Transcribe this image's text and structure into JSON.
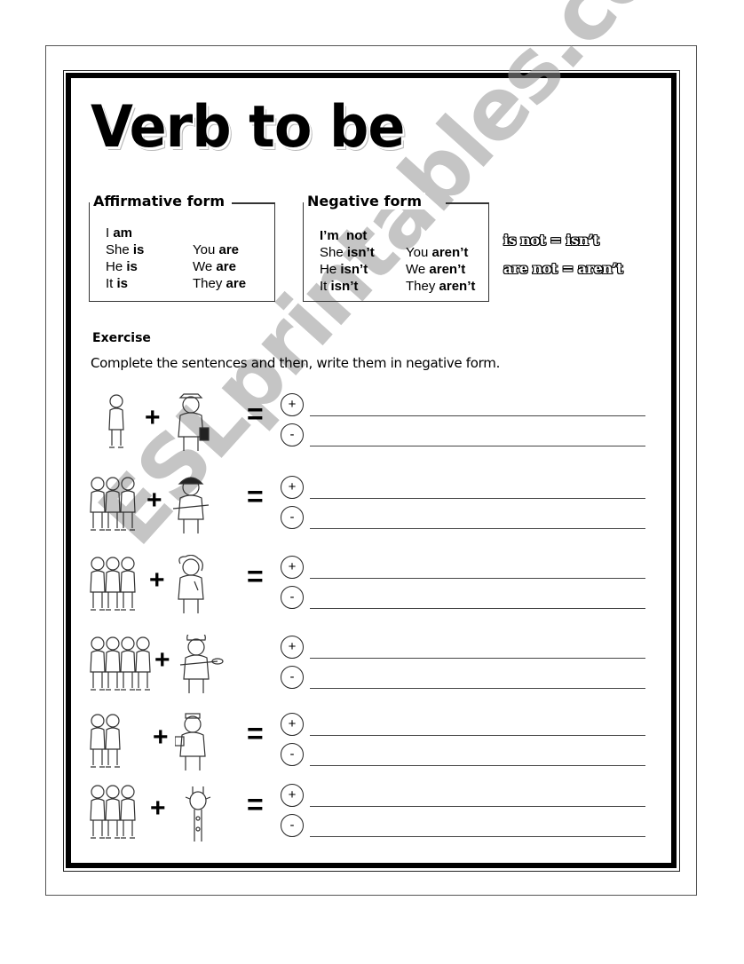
{
  "worksheet": {
    "title": "Verb to be",
    "affirmative": {
      "heading": "Affirmative form",
      "rows": [
        {
          "subject": "I",
          "verb": "am"
        },
        {
          "subject": "She",
          "verb": "is"
        },
        {
          "subject": "He",
          "verb": "is"
        },
        {
          "subject": "It",
          "verb": "is"
        },
        {
          "subject": "You",
          "verb": "are"
        },
        {
          "subject": "We",
          "verb": "are"
        },
        {
          "subject": "They",
          "verb": "are"
        }
      ]
    },
    "negative": {
      "heading": "Negative form",
      "rows": [
        {
          "subject": "I’m",
          "verb": "not"
        },
        {
          "subject": "She",
          "verb": "isn’t"
        },
        {
          "subject": "He",
          "verb": "isn’t"
        },
        {
          "subject": "It",
          "verb": "isn’t"
        },
        {
          "subject": "You",
          "verb": "aren’t"
        },
        {
          "subject": "We",
          "verb": "aren’t"
        },
        {
          "subject": "They",
          "verb": "aren’t"
        }
      ]
    },
    "contractions": [
      "is not = isn’t",
      "are not = aren’t"
    ],
    "exercise": {
      "heading": "Exercise",
      "instruction": "Complete the sentences and then, write them in negative form.",
      "plus_symbol": "+",
      "equals_symbol": "=",
      "positive_marker": "+",
      "negative_marker": "-",
      "rows": [
        {
          "subject_picture": "one boy",
          "complement_picture": "postman",
          "has_equals": true
        },
        {
          "subject_picture": "three boys",
          "complement_picture": "firefighter",
          "has_equals": true
        },
        {
          "subject_picture": "two boys and a girl",
          "complement_picture": "singer",
          "has_equals": true
        },
        {
          "subject_picture": "four children",
          "complement_picture": "baker",
          "has_equals": false
        },
        {
          "subject_picture": "two boys",
          "complement_picture": "doctor",
          "has_equals": true
        },
        {
          "subject_picture": "three boys",
          "complement_picture": "giraffe",
          "has_equals": true
        }
      ]
    },
    "watermark": "ESLprintables.com"
  }
}
